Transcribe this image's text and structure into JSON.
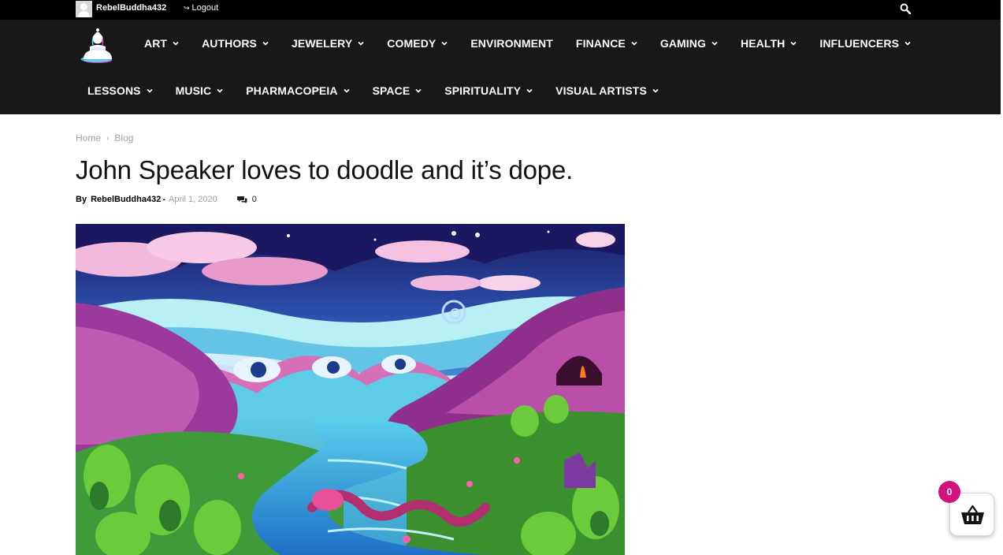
{
  "topbar": {
    "username": "RebelBuddha432",
    "logout_label": "Logout",
    "logout_icon": "sign-out-icon",
    "search_icon": "search-icon"
  },
  "nav": {
    "logo_icon": "buddha-logo-icon",
    "row1": [
      {
        "label": "ART"
      },
      {
        "label": "AUTHORS"
      },
      {
        "label": "JEWELERY"
      },
      {
        "label": "COMEDY"
      },
      {
        "label": "ENVIRONMENT",
        "no_chevron": true
      },
      {
        "label": "FINANCE"
      },
      {
        "label": "GAMING"
      },
      {
        "label": "HEALTH"
      },
      {
        "label": "INFLUENCERS"
      }
    ],
    "row2": [
      {
        "label": "LESSONS"
      },
      {
        "label": "MUSIC"
      },
      {
        "label": "PHARMACOPEIA"
      },
      {
        "label": "SPACE"
      },
      {
        "label": "SPIRITUALITY"
      },
      {
        "label": "VISUAL ARTISTS"
      }
    ]
  },
  "breadcrumb": {
    "home": "Home",
    "separator": "›",
    "current": "Blog"
  },
  "article": {
    "title": "John Speaker loves to doodle and it’s dope.",
    "by": "By",
    "author": "RebelBuddha432",
    "dash": "-",
    "date": "April 1, 2020",
    "comment_count": "0",
    "comment_icon": "comments-icon"
  },
  "cart": {
    "count": "0",
    "icon": "basket-icon",
    "badge_color": "#d1127a"
  }
}
